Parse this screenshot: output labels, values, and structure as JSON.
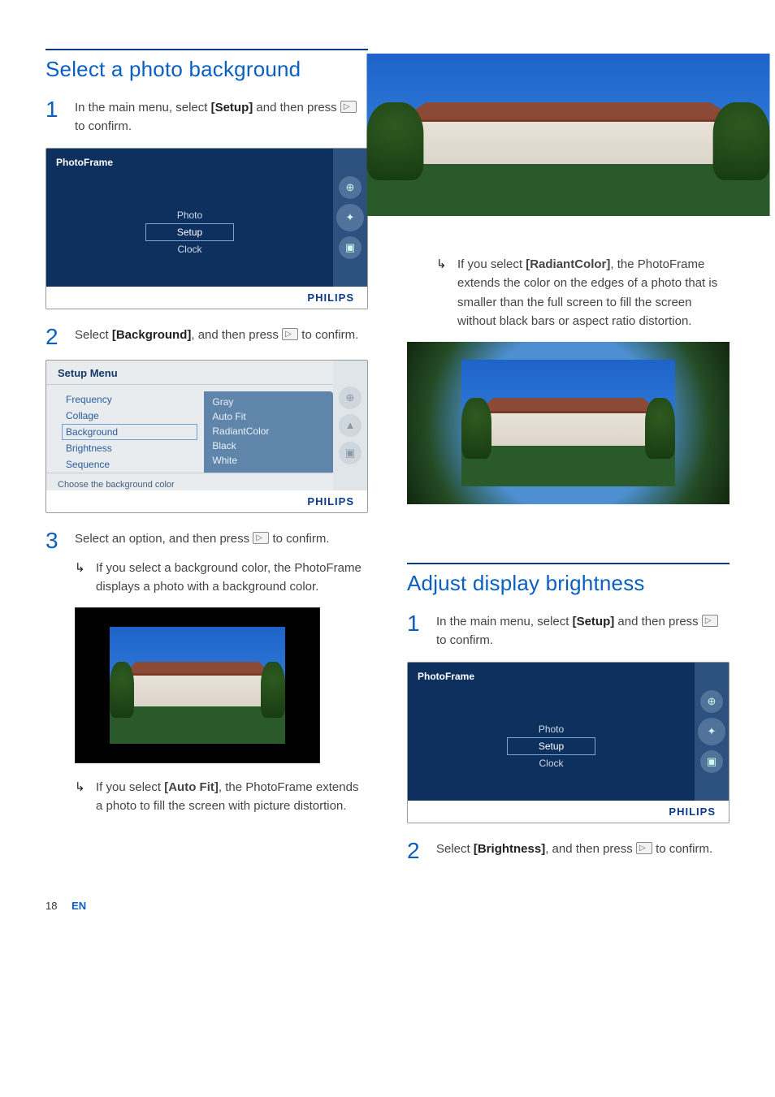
{
  "left": {
    "title": "Select a photo background",
    "step1": {
      "num": "1",
      "pre": "In the main menu, select ",
      "opt": "[Setup]",
      "mid": " and then press ",
      "post": " to confirm."
    },
    "device1": {
      "title": "PhotoFrame",
      "items": [
        "Photo",
        "Setup",
        "Clock"
      ],
      "selected": "Setup",
      "brand": "PHILIPS"
    },
    "step2": {
      "num": "2",
      "pre": "Select ",
      "opt": "[Background]",
      "mid": ", and then press ",
      "post": " to confirm."
    },
    "setup": {
      "head": "Setup Menu",
      "left_items": [
        "Frequency",
        "Collage",
        "Background",
        "Brightness",
        "Sequence"
      ],
      "left_hl": "Background",
      "right_items": [
        "Gray",
        "Auto Fit",
        "RadiantColor",
        "Black",
        "White"
      ],
      "foot": "Choose the background color",
      "brand": "PHILIPS"
    },
    "step3": {
      "num": "3",
      "pre": "Select an option, and then press ",
      "post": " to confirm."
    },
    "b1": "If you select a background color, the PhotoFrame displays a photo with a background color.",
    "b2_pre": "If you select ",
    "b2_opt": "[Auto Fit]",
    "b2_post": ", the PhotoFrame extends a photo to fill the screen with picture distortion."
  },
  "right": {
    "b3_pre": "If you select ",
    "b3_opt": "[RadiantColor]",
    "b3_post": ", the PhotoFrame extends the color on the edges of a photo that is smaller than the full screen to fill the screen without black bars or aspect ratio distortion.",
    "title2": "Adjust display brightness",
    "step1": {
      "num": "1",
      "pre": "In the main menu, select ",
      "opt": "[Setup]",
      "mid": " and then press ",
      "post": " to confirm."
    },
    "device2": {
      "title": "PhotoFrame",
      "items": [
        "Photo",
        "Setup",
        "Clock"
      ],
      "selected": "Setup",
      "brand": "PHILIPS"
    },
    "step2": {
      "num": "2",
      "pre": "Select ",
      "opt": "[Brightness]",
      "mid": ", and then press ",
      "post": " to confirm."
    }
  },
  "footer": {
    "page": "18",
    "lang": "EN"
  }
}
